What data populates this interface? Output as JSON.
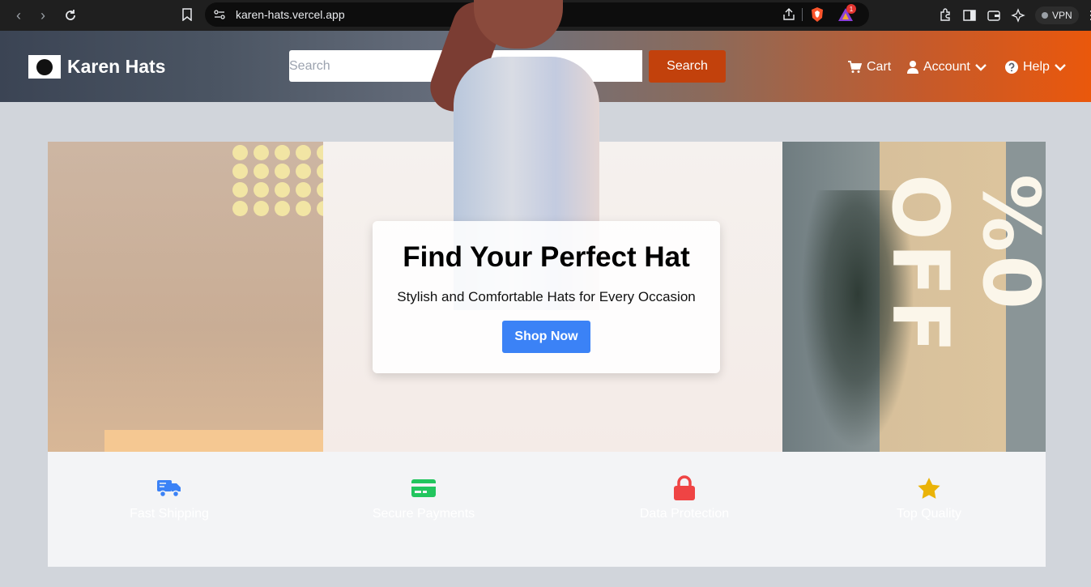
{
  "browser": {
    "url": "karen-hats.vercel.app",
    "vpn_label": "VPN",
    "rewards_badge": "1"
  },
  "header": {
    "brand": "Karen Hats",
    "search_placeholder": "Search",
    "search_button": "Search",
    "nav": {
      "cart": "Cart",
      "account": "Account",
      "help": "Help"
    }
  },
  "hero": {
    "title": "Find Your Perfect Hat",
    "subtitle": "Stylish and Comfortable Hats for Every Occasion",
    "cta": "Shop Now",
    "banner_text": "%0 OFF"
  },
  "features": [
    {
      "label": "Fast Shipping",
      "icon": "truck-icon",
      "color": "#3b82f6"
    },
    {
      "label": "Secure Payments",
      "icon": "credit-card-icon",
      "color": "#22c55e"
    },
    {
      "label": "Data Protection",
      "icon": "lock-icon",
      "color": "#ef4444"
    },
    {
      "label": "Top Quality",
      "icon": "star-icon",
      "color": "#eab308"
    }
  ],
  "colors": {
    "search_button": "#c2410c",
    "cta": "#3b82f6",
    "header_gradient_end": "#ea580c"
  }
}
